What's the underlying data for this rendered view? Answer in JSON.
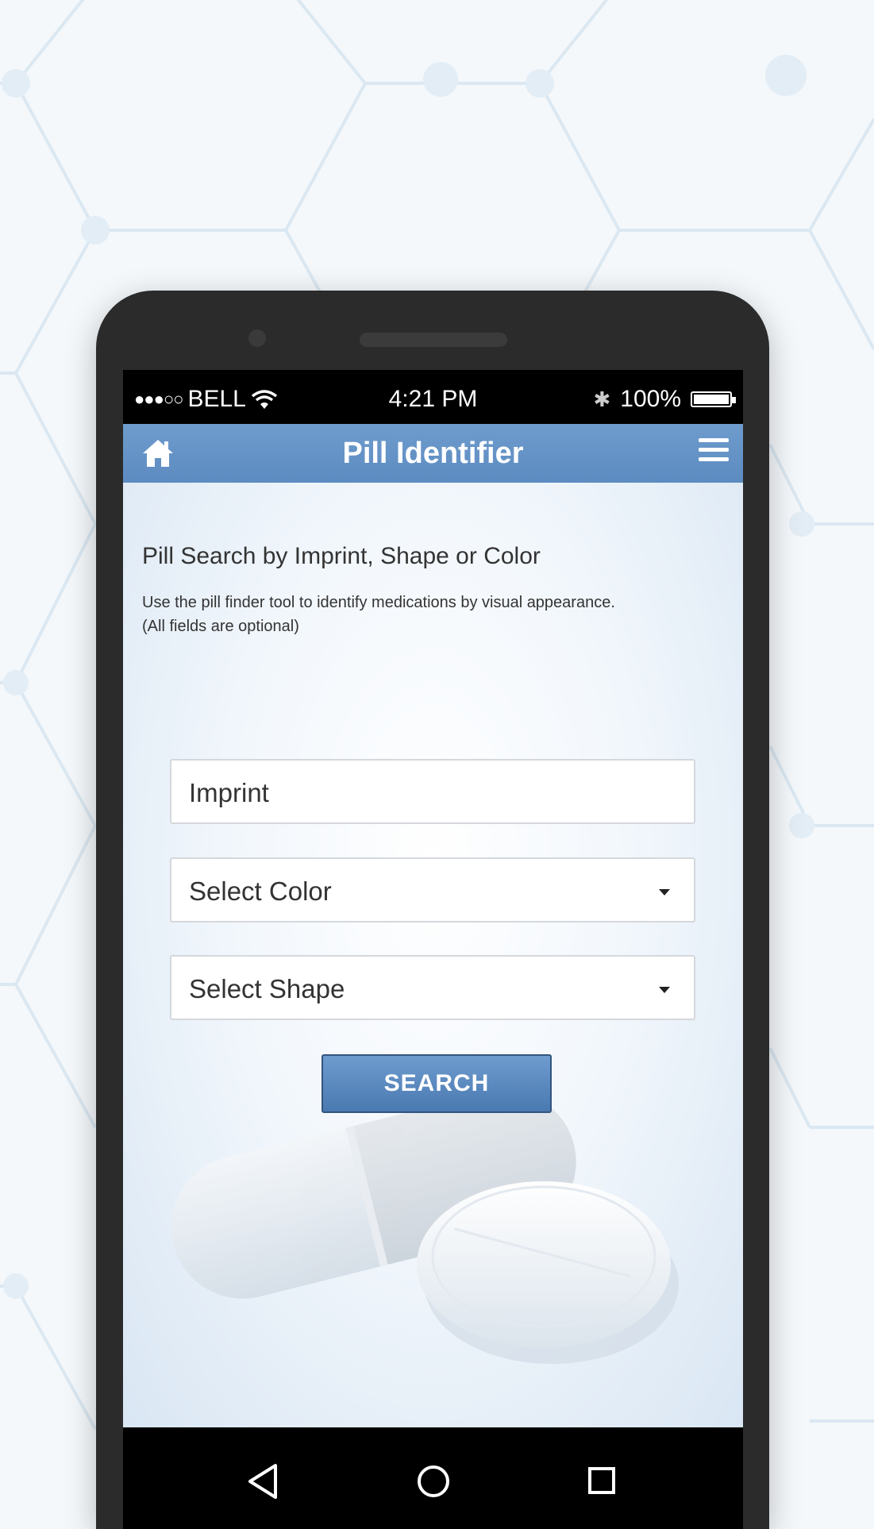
{
  "status_bar": {
    "carrier": "BELL",
    "time": "4:21 PM",
    "battery_percent": "100%",
    "signal_dots": "●●●○○",
    "bluetooth_glyph": "✱",
    "icons": [
      "wifi-icon",
      "bluetooth-icon",
      "battery-icon"
    ]
  },
  "app_bar": {
    "title": "Pill Identifier",
    "left_icon": "home-icon",
    "right_icon": "menu-icon",
    "color": "#6795c8"
  },
  "page": {
    "heading": "Pill Search by Imprint, Shape or Color",
    "description_line1": "Use the pill finder tool to identify medications by visual appearance.",
    "description_line2": "(All fields are optional)"
  },
  "form": {
    "imprint_placeholder": "Imprint",
    "color_select": "Select Color",
    "shape_select": "Select Shape",
    "search_label": "SEARCH"
  },
  "nav_bar": {
    "icons": [
      "back-icon",
      "home-circle-icon",
      "recents-icon"
    ]
  },
  "colors": {
    "accent": "#5c8bc1",
    "button_border": "#33557f",
    "phone_body": "#2b2b2b"
  }
}
